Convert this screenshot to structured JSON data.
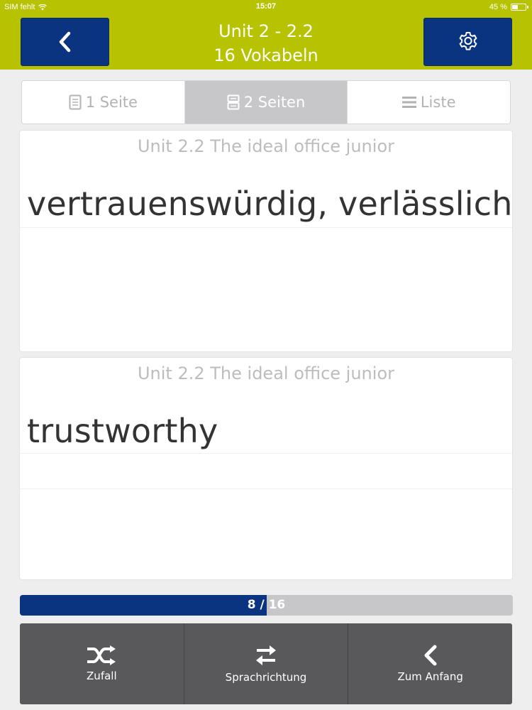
{
  "status_bar": {
    "carrier": "SIM fehlt",
    "time": "15:07",
    "battery_text": "45 %",
    "battery_level": 0.45
  },
  "header": {
    "title": "Unit 2 - 2.2",
    "subtitle": "16 Vokabeln",
    "back_icon": "chevron-left-icon",
    "settings_icon": "gear-icon"
  },
  "view_modes": [
    {
      "label": "1 Seite",
      "icon": "page-icon",
      "active": false
    },
    {
      "label": "2 Seiten",
      "icon": "two-pages-icon",
      "active": true
    },
    {
      "label": "Liste",
      "icon": "list-icon",
      "active": false
    }
  ],
  "cards": [
    {
      "unit": "Unit 2.2 The ideal office junior",
      "word": "vertrauenswürdig, verlässlich"
    },
    {
      "unit": "Unit 2.2 The ideal office junior",
      "word": "trustworthy"
    }
  ],
  "progress": {
    "text": "8 / 16",
    "current": 8,
    "total": 16
  },
  "toolbar": [
    {
      "label": "Zufall",
      "icon": "shuffle-icon"
    },
    {
      "label": "Sprachrichtung",
      "icon": "swap-arrows-icon"
    },
    {
      "label": "Zum Anfang",
      "icon": "chevron-left-icon"
    }
  ],
  "colors": {
    "accent_green": "#b7c300",
    "primary_blue": "#0b3480",
    "toolbar_gray": "#59595b",
    "segment_active": "#c7c7c9"
  }
}
